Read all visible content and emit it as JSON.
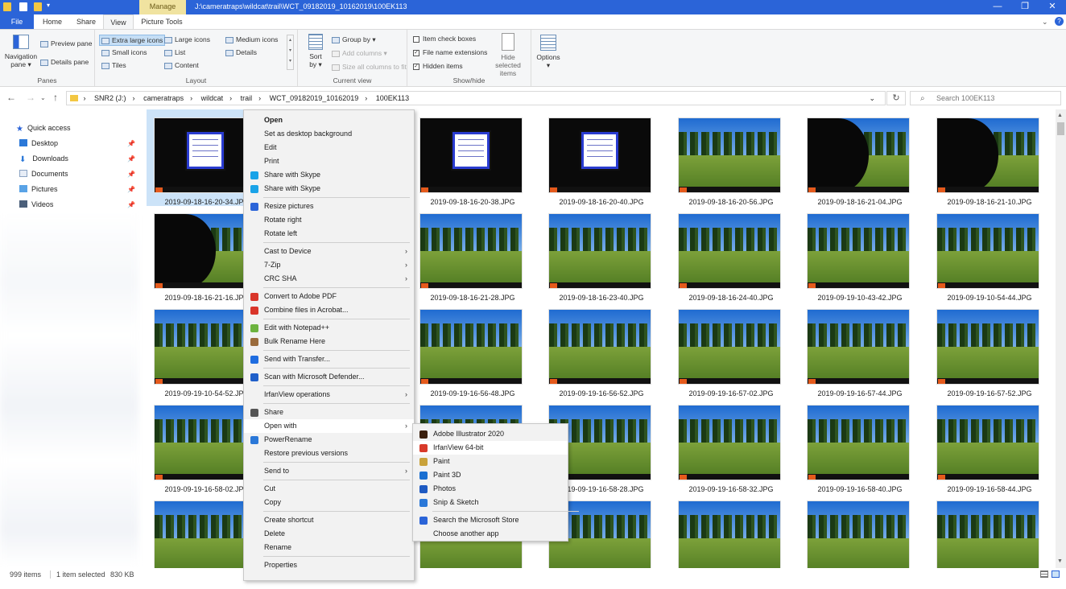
{
  "window": {
    "manage_tab": "Manage",
    "title_path": "J:\\cameratraps\\wildcat\\trail\\WCT_09182019_10162019\\100EK113",
    "min": "—",
    "max": "❐",
    "close": "✕"
  },
  "ribbon_tabs": {
    "file": "File",
    "home": "Home",
    "share": "Share",
    "view": "View",
    "picture_tools": "Picture Tools"
  },
  "ribbon": {
    "panes": {
      "nav_pane": "Navigation pane",
      "preview_pane": "Preview pane",
      "details_pane": "Details pane",
      "label": "Panes"
    },
    "layout": {
      "extra_large": "Extra large icons",
      "large": "Large icons",
      "medium": "Medium icons",
      "small": "Small icons",
      "list": "List",
      "details": "Details",
      "tiles": "Tiles",
      "content": "Content",
      "label": "Layout"
    },
    "current_view": {
      "sort_by": "Sort by",
      "group_by": "Group by",
      "add_columns": "Add columns",
      "size_all": "Size all columns to fit",
      "label": "Current view"
    },
    "show_hide": {
      "item_check_boxes": "Item check boxes",
      "file_name_extensions": "File name extensions",
      "hidden_items": "Hidden items",
      "hide_selected": "Hide selected items",
      "label": "Show/hide"
    },
    "options": "Options"
  },
  "address": {
    "crumbs": [
      "SNR2 (J:)",
      "cameratraps",
      "wildcat",
      "trail",
      "WCT_09182019_10162019",
      "100EK113"
    ],
    "search_placeholder": "Search 100EK113"
  },
  "sidebar": {
    "quick_access": "Quick access",
    "items": [
      "Desktop",
      "Downloads",
      "Documents",
      "Pictures",
      "Videos"
    ]
  },
  "files": [
    {
      "name": "2019-09-18-16-20-34.JPG",
      "kind": "card",
      "selected": true
    },
    {
      "name": "2019-09-18-16-20-38.JPG",
      "kind": "card"
    },
    {
      "name": "2019-09-18-16-20-40.JPG",
      "kind": "card"
    },
    {
      "name": "2019-09-18-16-20-56.JPG",
      "kind": "meadow"
    },
    {
      "name": "2019-09-18-16-21-04.JPG",
      "kind": "dark"
    },
    {
      "name": "2019-09-18-16-21-10.JPG",
      "kind": "dark"
    },
    {
      "name": "2019-09-18-16-21-16.JPG",
      "kind": "dark"
    },
    {
      "name": "2019-09-18-16-21-28.JPG",
      "kind": "meadow"
    },
    {
      "name": "2019-09-18-16-23-40.JPG",
      "kind": "meadow"
    },
    {
      "name": "2019-09-18-16-24-40.JPG",
      "kind": "meadow"
    },
    {
      "name": "2019-09-19-10-43-42.JPG",
      "kind": "meadow"
    },
    {
      "name": "2019-09-19-10-54-44.JPG",
      "kind": "meadow"
    },
    {
      "name": "2019-09-19-10-54-52.JPG",
      "kind": "meadow"
    },
    {
      "name": "2019-09-19-16-56-48.JPG",
      "kind": "meadow"
    },
    {
      "name": "2019-09-19-16-56-52.JPG",
      "kind": "meadow"
    },
    {
      "name": "2019-09-19-16-57-02.JPG",
      "kind": "meadow"
    },
    {
      "name": "2019-09-19-16-57-44.JPG",
      "kind": "meadow"
    },
    {
      "name": "2019-09-19-16-57-52.JPG",
      "kind": "meadow"
    },
    {
      "name": "2019-09-19-16-58-02.JPG",
      "kind": "meadow"
    },
    {
      "name": "",
      "kind": "meadow"
    },
    {
      "name": "2019-09-19-16-58-28.JPG",
      "kind": "meadow"
    },
    {
      "name": "2019-09-19-16-58-32.JPG",
      "kind": "meadow"
    },
    {
      "name": "2019-09-19-16-58-40.JPG",
      "kind": "meadow"
    },
    {
      "name": "2019-09-19-16-58-44.JPG",
      "kind": "meadow"
    },
    {
      "name": "",
      "kind": "meadow"
    },
    {
      "name": "",
      "kind": "meadow"
    },
    {
      "name": "",
      "kind": "meadow"
    },
    {
      "name": "",
      "kind": "meadow"
    },
    {
      "name": "",
      "kind": "meadow"
    },
    {
      "name": "",
      "kind": "meadow"
    }
  ],
  "context_menu": [
    {
      "label": "Open",
      "bold": true
    },
    {
      "label": "Set as desktop background"
    },
    {
      "label": "Edit"
    },
    {
      "label": "Print"
    },
    {
      "label": "Share with Skype",
      "icon": "skype-icon"
    },
    {
      "label": "Share with Skype",
      "icon": "skype-icon"
    },
    {
      "sep": true
    },
    {
      "label": "Resize pictures",
      "icon": "resize-icon"
    },
    {
      "label": "Rotate right"
    },
    {
      "label": "Rotate left"
    },
    {
      "sep": true
    },
    {
      "label": "Cast to Device",
      "arrow": true
    },
    {
      "label": "7-Zip",
      "arrow": true
    },
    {
      "label": "CRC SHA",
      "arrow": true
    },
    {
      "sep": true
    },
    {
      "label": "Convert to Adobe PDF",
      "icon": "pdf-icon"
    },
    {
      "label": "Combine files in Acrobat...",
      "icon": "pdf-icon"
    },
    {
      "sep": true
    },
    {
      "label": "Edit with Notepad++",
      "icon": "notepad-icon"
    },
    {
      "label": "Bulk Rename Here",
      "icon": "rename-icon"
    },
    {
      "sep": true
    },
    {
      "label": "Send with Transfer...",
      "icon": "dropbox-icon"
    },
    {
      "sep": true
    },
    {
      "label": "Scan with Microsoft Defender...",
      "icon": "defender-icon"
    },
    {
      "sep": true
    },
    {
      "label": "IrfanView operations",
      "arrow": true
    },
    {
      "sep": true
    },
    {
      "label": "Share",
      "icon": "share-icon"
    },
    {
      "label": "Open with",
      "arrow": true,
      "highlight": true
    },
    {
      "label": "PowerRename",
      "icon": "powerrename-icon"
    },
    {
      "label": "Restore previous versions"
    },
    {
      "sep": true
    },
    {
      "label": "Send to",
      "arrow": true
    },
    {
      "sep": true
    },
    {
      "label": "Cut"
    },
    {
      "label": "Copy"
    },
    {
      "sep": true
    },
    {
      "label": "Create shortcut"
    },
    {
      "label": "Delete"
    },
    {
      "label": "Rename"
    },
    {
      "sep": true
    },
    {
      "label": "Properties"
    }
  ],
  "open_with_menu": [
    {
      "label": "Adobe Illustrator 2020",
      "icon": "illustrator-icon"
    },
    {
      "label": "IrfanView 64-bit",
      "icon": "irfanview-icon",
      "highlight": true
    },
    {
      "label": "Paint",
      "icon": "paint-icon"
    },
    {
      "label": "Paint 3D",
      "icon": "paint3d-icon"
    },
    {
      "label": "Photos",
      "icon": "photos-icon"
    },
    {
      "label": "Snip & Sketch",
      "icon": "snip-icon"
    },
    {
      "sep": true
    },
    {
      "label": "Search the Microsoft Store",
      "icon": "store-icon"
    },
    {
      "label": "Choose another app"
    }
  ],
  "status": {
    "items": "999 items",
    "selected": "1 item selected",
    "size": "830 KB"
  },
  "colors": {
    "accent": "#2b64d8",
    "manage": "#f0e3a0",
    "selection": "#cce3f8"
  }
}
